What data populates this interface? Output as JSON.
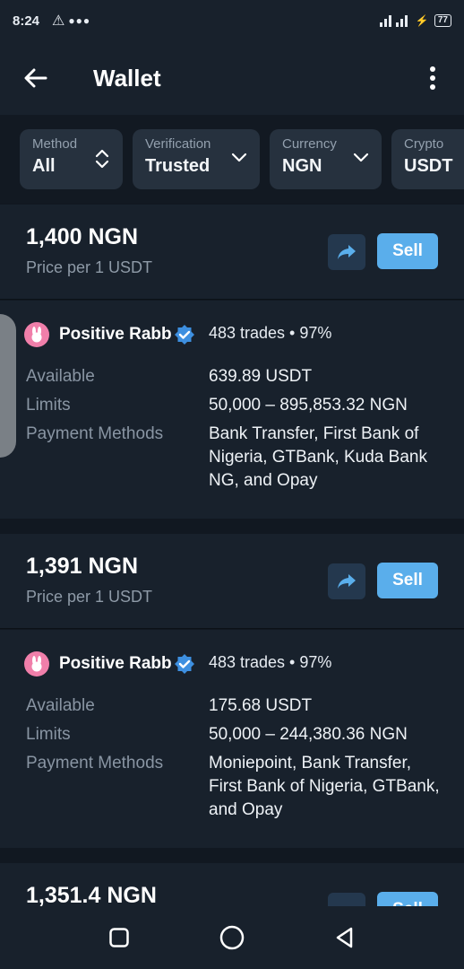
{
  "status_bar": {
    "time": "8:24",
    "battery": "77"
  },
  "app_bar": {
    "title": "Wallet"
  },
  "filters": [
    {
      "label": "Method",
      "value": "All",
      "icon": "up-down-chevron-icon"
    },
    {
      "label": "Verification",
      "value": "Trusted",
      "icon": "chevron-down-icon"
    },
    {
      "label": "Currency",
      "value": "NGN",
      "icon": "chevron-down-icon"
    },
    {
      "label": "Crypto",
      "value": "USDT",
      "icon": "chevron-down-icon"
    }
  ],
  "offers": [
    {
      "price": "1,400 NGN",
      "price_sub": "Price per 1 USDT",
      "sell_label": "Sell",
      "trader": "Positive Rabb",
      "trades": "483 trades • 97%",
      "available_label": "Available",
      "available": "639.89 USDT",
      "limits_label": "Limits",
      "limits": "50,000 – 895,853.32 NGN",
      "payment_label": "Payment Methods",
      "payment": "Bank Transfer, First Bank of Nigeria, GTBank, Kuda Bank NG, and Opay"
    },
    {
      "price": "1,391 NGN",
      "price_sub": "Price per 1 USDT",
      "sell_label": "Sell",
      "trader": "Positive Rabb",
      "trades": "483 trades • 97%",
      "available_label": "Available",
      "available": "175.68 USDT",
      "limits_label": "Limits",
      "limits": "50,000 – 244,380.36 NGN",
      "payment_label": "Payment Methods",
      "payment": "Moniepoint, Bank Transfer, First Bank of Nigeria, GTBank, and Opay"
    },
    {
      "price": "1,351.4 NGN",
      "sell_label": "Sell"
    }
  ],
  "colors": {
    "background": "#111821",
    "card": "#18212c",
    "accent": "#5aaeeb",
    "verified": "#3d8fe0",
    "avatar": "#f07faa"
  }
}
